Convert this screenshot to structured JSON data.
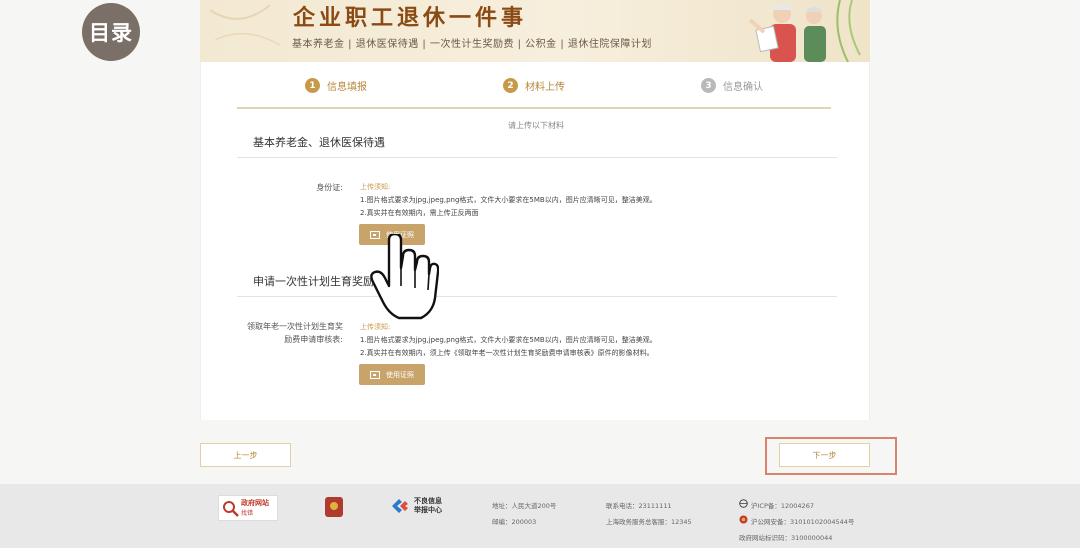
{
  "toc_badge": "目录",
  "banner": {
    "title": "企业职工退休一件事",
    "subtitle": "基本养老金 | 退休医保待遇 | 一次性计生奖励费 | 公积金 | 退休住院保障计划"
  },
  "steps": [
    {
      "num": "1",
      "label": "信息填报",
      "state": "active"
    },
    {
      "num": "2",
      "label": "材料上传",
      "state": "active"
    },
    {
      "num": "3",
      "label": "信息确认",
      "state": "pending"
    }
  ],
  "upload_hint": "请上传以下材料",
  "section1": {
    "title": "基本养老金、退休医保待遇",
    "field_label": "身份证:",
    "req_head": "上传须知:",
    "req_lines": [
      "1.图片格式要求为jpg,jpeg,png格式，文件大小要求在5MB以内，图片应清晰可见，整洁美观。",
      "2.真实并在有效期内，需上传正反两面"
    ],
    "button": "使用证照"
  },
  "section2": {
    "title": "申请一次性计划生育奖励",
    "field_label_line1": "领取年老一次性计划生育奖",
    "field_label_line2": "励费申请审核表:",
    "req_head": "上传须知:",
    "req_lines": [
      "1.图片格式要求为jpg,jpeg,png格式，文件大小要求在5MB以内，图片应清晰可见，整洁美观。",
      "2.真实并在有效期内，须上传《领取年老一次性计划生育奖励费申请审核表》原件的影像材料。"
    ],
    "button": "使用证照"
  },
  "nav": {
    "prev": "上一步",
    "next": "下一步"
  },
  "footer": {
    "logo1_title": "政府网站",
    "logo1_sub": "找错",
    "report_line1": "不良信息",
    "report_line2": "举报中心",
    "address": "地址：人民大道200号",
    "postcode": "邮编：200003",
    "phone": "联系电话：23111111",
    "hotline": "上海政务服务总客服：12345",
    "icp": "沪ICP备：12004267",
    "police": "沪公网安备：31010102004544号",
    "site_code": "政府网站标识码：3100000044"
  }
}
